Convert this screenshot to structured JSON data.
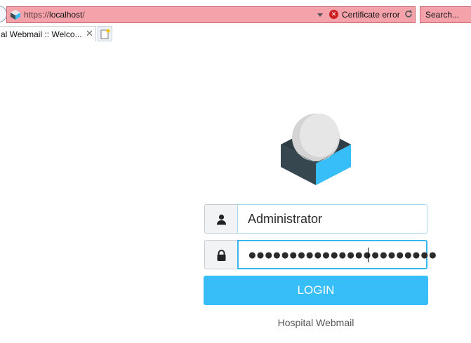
{
  "browser": {
    "url_prefix": "https://",
    "url_host": "localhost",
    "url_suffix": "/",
    "cert_error_label": "Certificate error",
    "search_placeholder": "Search...",
    "tab_title": "al Webmail :: Welco...",
    "tab_close": "✕",
    "colors": {
      "address_bar_error": "#f5a3ab",
      "cert_error_icon": "#cc1f1f"
    },
    "icons": [
      "site-favicon-icon",
      "dropdown-arrow-icon",
      "certificate-error-icon",
      "refresh-icon",
      "new-tab-icon"
    ]
  },
  "login": {
    "username_value": "Administrator",
    "password_masked": "●●●●●●●●●●●●●●●●●●●●●●●",
    "submit_label": "LOGIN",
    "footer": "Hospital Webmail",
    "icons": [
      "roundcube-logo",
      "user-icon",
      "lock-icon"
    ],
    "colors": {
      "accent": "#37bdf8",
      "focus_border": "#39b6f0"
    }
  }
}
